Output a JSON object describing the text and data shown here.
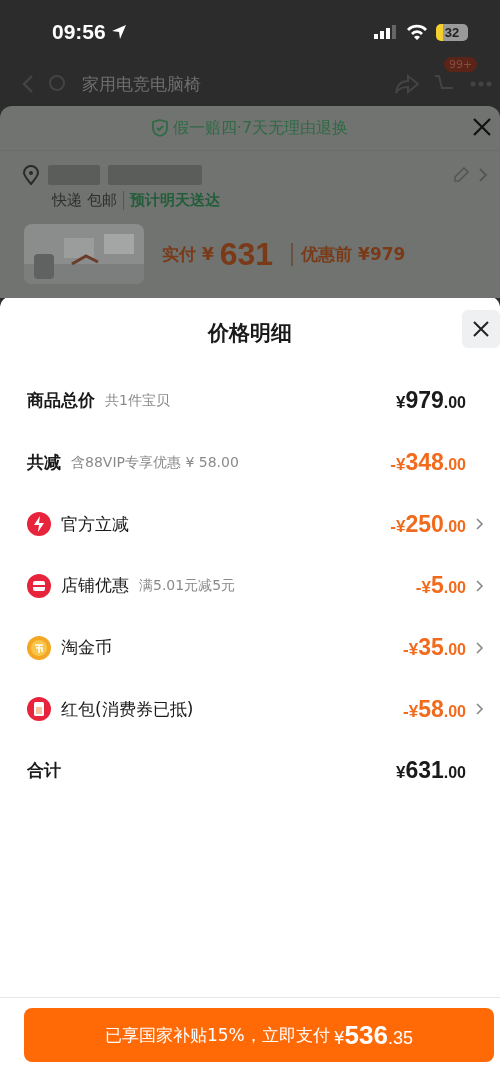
{
  "status_bar": {
    "time": "09:56",
    "battery": "32"
  },
  "background_page": {
    "search_placeholder": "家用电竞电脑椅",
    "cart_badge": "99+",
    "guarantee": "假一赔四·7天无理由退换",
    "shipping": "快递 包邮",
    "delivery": "预计明天送达",
    "paid_label": "实付 ¥",
    "paid_amount": "631",
    "original_price": "优惠前 ¥979"
  },
  "sheet": {
    "title": "价格明细",
    "rows": [
      {
        "kind": "summary",
        "label": "商品总价",
        "note": "共1件宝贝",
        "amount": "¥979.00",
        "discount": false,
        "expandable": false
      },
      {
        "kind": "summary",
        "label": "共减",
        "note": "含88VIP专享优惠 ¥ 58.00",
        "amount": "-¥348.00",
        "discount": true,
        "expandable": false
      },
      {
        "kind": "lightning",
        "label": "官方立减",
        "amount": "-¥250.00",
        "discount": true,
        "expandable": true
      },
      {
        "kind": "store",
        "label": "店铺优惠",
        "note": "满5.01元减5元",
        "amount": "-¥5.00",
        "discount": true,
        "expandable": true
      },
      {
        "kind": "coin",
        "label": "淘金币",
        "amount": "-¥35.00",
        "discount": true,
        "expandable": true
      },
      {
        "kind": "envelope",
        "label": "红包(消费券已抵)",
        "amount": "-¥58.00",
        "discount": true,
        "expandable": true
      },
      {
        "kind": "total",
        "label": "合计",
        "amount": "¥631.00",
        "discount": false,
        "expandable": false
      }
    ]
  },
  "pay_button": {
    "label": "已享国家补贴15%，立即支付",
    "amount": "¥536.35"
  }
}
